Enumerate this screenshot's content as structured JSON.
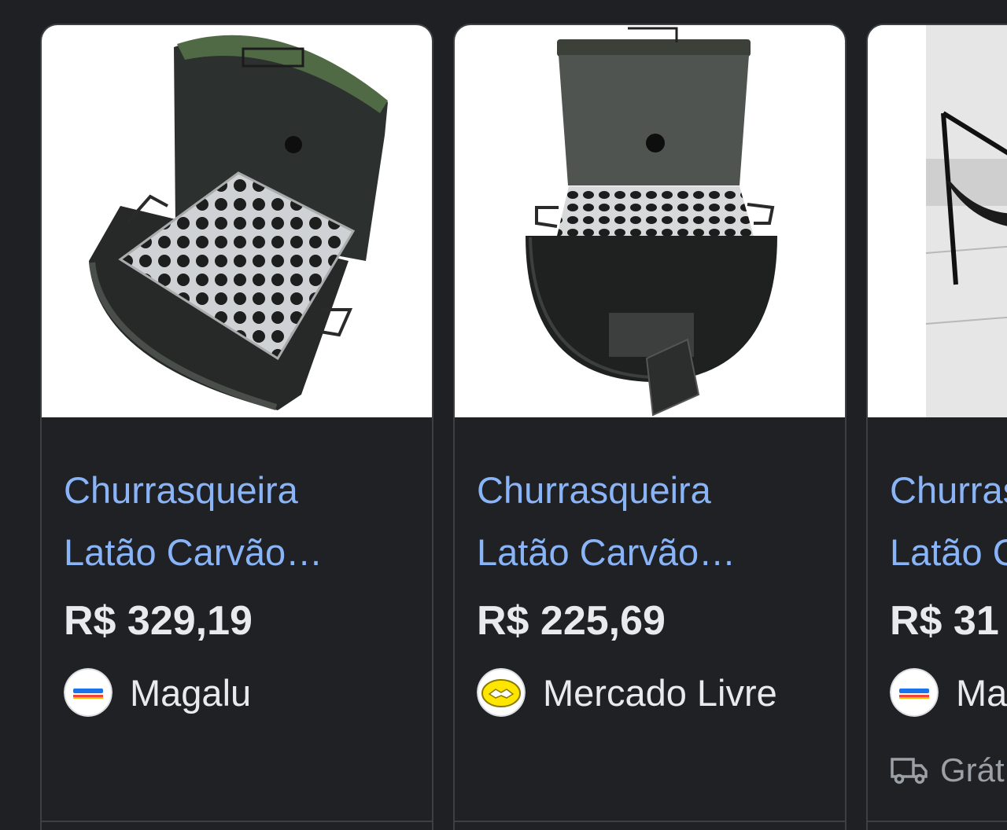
{
  "products": [
    {
      "title_line1": "Churrasqueira",
      "title_line2": "Latão Carvão…",
      "price": "R$ 329,19",
      "seller": "Magalu",
      "seller_logo_icon": "magalu-logo-icon",
      "image_subject": "open barrel charcoal grill with perforated grate"
    },
    {
      "title_line1": "Churrasqueira",
      "title_line2": "Latão Carvão…",
      "price": "R$ 225,69",
      "seller": "Mercado Livre",
      "seller_logo_icon": "mercado-livre-logo-icon",
      "image_subject": "barrel charcoal grill front view with ash door"
    },
    {
      "title_line1": "Churrasqueira",
      "title_line2": "Latão Carvão…",
      "price": "R$ 31",
      "seller": "Magalu",
      "seller_logo_icon": "magalu-logo-icon",
      "shipping": "Grát",
      "shipping_icon": "delivery-truck-icon",
      "image_subject": "half barrel grill on metal stand in tiled room"
    }
  ],
  "colors": {
    "page_background": "#1f2024",
    "card_border": "#3c4043",
    "title_link": "#8ab4f8",
    "primary_text": "#e8eaed",
    "secondary_text": "#9aa0a6"
  }
}
